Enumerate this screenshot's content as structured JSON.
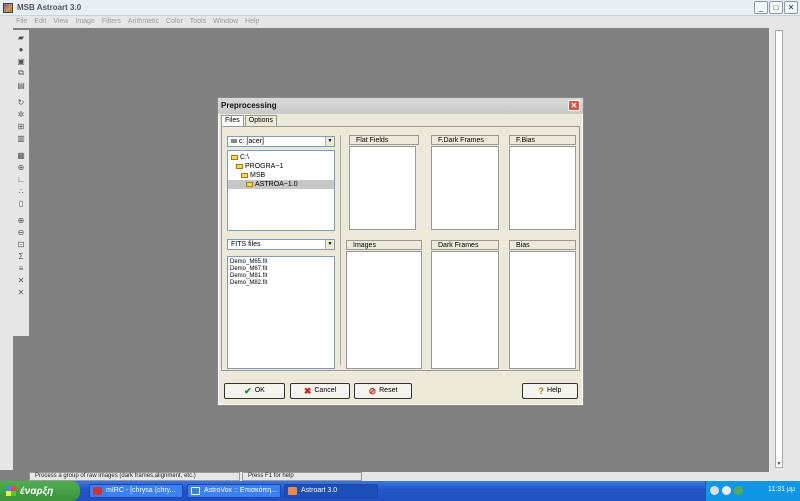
{
  "window": {
    "title": "MSB Astroart 3.0",
    "controls": [
      "_",
      "□",
      "✕"
    ]
  },
  "menu": [
    "File",
    "Edit",
    "View",
    "Image",
    "Filters",
    "Arithmetic",
    "Color",
    "Tools",
    "Window",
    "Help"
  ],
  "toolbar": {
    "groups": [
      [
        "open-icon",
        "open-folder-icon",
        "save-icon",
        "copy-icon",
        "paste-icon"
      ],
      [
        "rotate-icon",
        "star-icon",
        "frame-icon",
        "columns-icon"
      ],
      [
        "layers-icon",
        "zoom-icon",
        "graph-icon",
        "points-icon",
        "trash-icon"
      ],
      [
        "zoom-in-icon",
        "zoom-out-icon",
        "fit-icon",
        "sum-icon",
        "align-icon",
        "expand-icon",
        "shrink-icon"
      ]
    ]
  },
  "dialog": {
    "title": "Preprocessing",
    "close_glyph": "✕",
    "tabs": [
      {
        "label": "Files",
        "active": true
      },
      {
        "label": "Options",
        "active": false
      }
    ],
    "drive": "c: [acer]",
    "directories": [
      {
        "label": "C:\\",
        "indent": 0,
        "selected": false
      },
      {
        "label": "PROGRA~1",
        "indent": 1,
        "selected": false
      },
      {
        "label": "MSB",
        "indent": 2,
        "selected": false
      },
      {
        "label": "ASTROA~1.0",
        "indent": 3,
        "selected": true
      }
    ],
    "filter": "FITS files",
    "files": [
      "Demo_M65.fit",
      "Demo_M67.fit",
      "Demo_M81.fit",
      "Demo_M82.fit"
    ],
    "groups": {
      "flat_fields": "Flat Fields",
      "f_dark_frames": "F.Dark Frames",
      "f_bias": "F.Bias",
      "images": "Images",
      "dark_frames": "Dark Frames",
      "bias": "Bias"
    },
    "buttons": {
      "ok": "OK",
      "cancel": "Cancel",
      "reset": "Reset",
      "help": "Help"
    }
  },
  "status": {
    "left": "Process a group of raw images (dark frames,alignment, etc.)",
    "right": "Press F1 for help"
  },
  "taskbar": {
    "start": "έναρξη",
    "tasks": [
      {
        "label": "mIRC - [chrysa (chry...",
        "active": false,
        "color": "#c33"
      },
      {
        "label": "AstroVox :: Επισκόπη...",
        "active": false,
        "color": "#38c"
      },
      {
        "label": "Astroart 3.0",
        "active": true,
        "color": "#e84"
      }
    ],
    "clock": "11:31 μμ"
  }
}
